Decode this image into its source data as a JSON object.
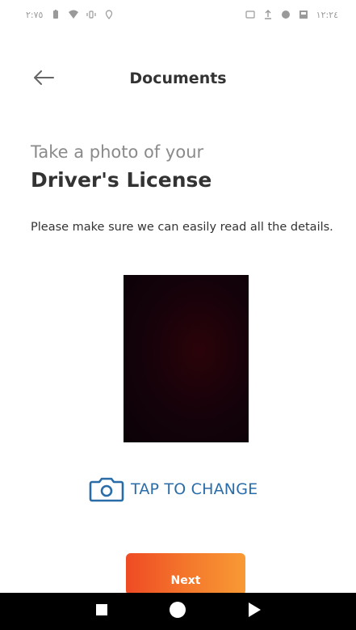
{
  "status_bar": {
    "left_text": "٢:٧٥",
    "right_text": "١٢:٢٤",
    "icons_left": [
      "battery-icon",
      "wifi-icon",
      "vibrate-icon",
      "location-icon"
    ],
    "icons_right": [
      "nfc-icon",
      "upload-icon",
      "messenger-icon",
      "gallery-icon"
    ]
  },
  "app_bar": {
    "title": "Documents",
    "back_icon": "arrow-left-icon"
  },
  "content": {
    "heading_small": "Take a photo of your",
    "heading_big": "Driver's License",
    "instructions": "Please make sure we can easily read all the details."
  },
  "photo": {
    "description_icon": "document-photo"
  },
  "tap_change": {
    "label": "TAP TO CHANGE",
    "icon": "camera-icon",
    "color": "#2a6ca8"
  },
  "next_button": {
    "label": "Next",
    "gradient_start": "#ef4b24",
    "gradient_end": "#f89a35"
  },
  "nav_bar": {
    "buttons": [
      "recents-icon",
      "home-icon",
      "back-icon"
    ]
  }
}
